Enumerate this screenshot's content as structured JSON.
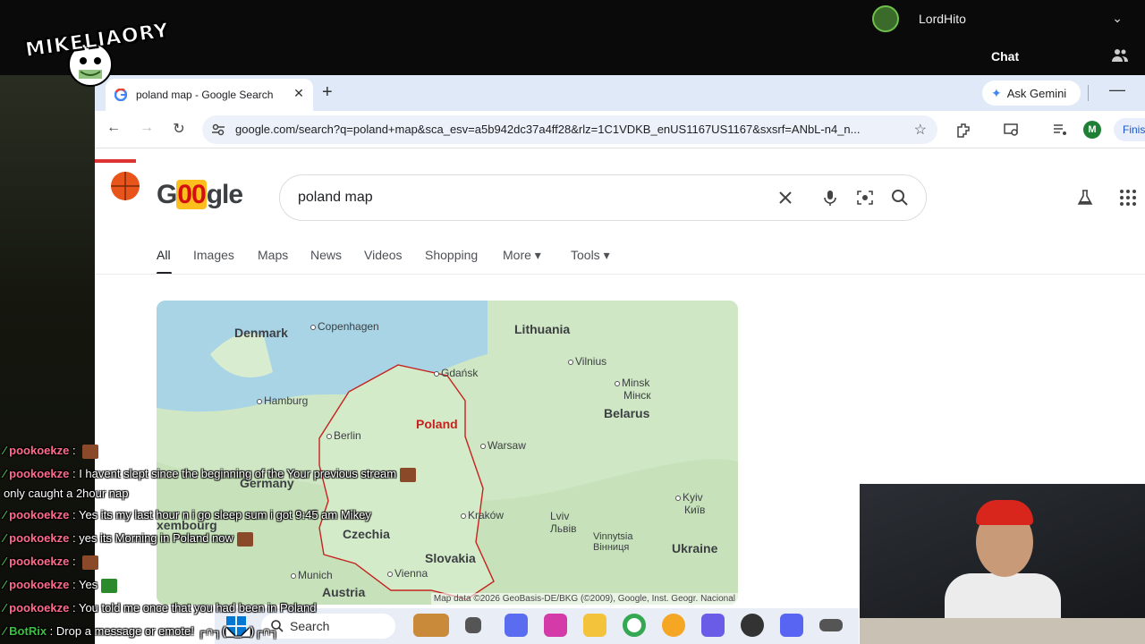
{
  "stream": {
    "logo_text": "MIKELIAORY",
    "username": "LordHito",
    "chat_title": "Chat"
  },
  "browser": {
    "tab_title": "poland map - Google Search",
    "ask_gemini_label": "Ask Gemini",
    "url": "google.com/search?q=poland+map&sca_esv=a5b942dc37a4ff28&rlz=1C1VDKB_enUS1167US1167&sxsrf=ANbL-n4_n...",
    "profile_initial": "M",
    "finish_label": "Finis"
  },
  "google": {
    "logo_g": "G",
    "logo_oo": "00",
    "logo_gle": "gle",
    "search_query": "poland map",
    "filters": [
      "All",
      "Images",
      "Maps",
      "News",
      "Videos",
      "Shopping",
      "More ▾",
      "Tools ▾"
    ]
  },
  "map": {
    "countries": {
      "denmark": "Denmark",
      "lithuania": "Lithuania",
      "poland": "Poland",
      "belarus": "Belarus",
      "germany": "Germany",
      "czechia": "Czechia",
      "slovakia": "Slovakia",
      "austria": "Austria",
      "ukraine": "Ukraine",
      "luxembourg": "xembourg"
    },
    "cities": {
      "copenhagen": "Copenhagen",
      "gdansk": "Gdańsk",
      "vilnius": "Vilnius",
      "minsk": "Minsk",
      "minsk_cyr": "Мінск",
      "hamburg": "Hamburg",
      "berlin": "Berlin",
      "warsaw": "Warsaw",
      "krakow": "Kraków",
      "lviv": "Lviv",
      "lviv_cyr": "Львів",
      "kyiv": "Kyiv",
      "kyiv_cyr": "Київ",
      "vinnytsia": "Vinnytsia",
      "vinnytsia_cyr": "Вінниця",
      "munich": "Munich",
      "vienna": "Vienna"
    },
    "attribution": "Map data ©2026 GeoBasis-DE/BKG (©2009), Google, Inst. Geogr. Nacional"
  },
  "chat": [
    {
      "user": "pookoekze",
      "text": ""
    },
    {
      "user": "pookoekze",
      "text": "I havent slept since the beginning of the Your previous stream"
    },
    {
      "user": "",
      "text": "only caught a 2hour nap"
    },
    {
      "user": "pookoekze",
      "text": "Yes its my last hour n i go sleep sum i got 9:45 am Mikey"
    },
    {
      "user": "pookoekze",
      "text": "yes its Morning in Poland now"
    },
    {
      "user": "pookoekze",
      "text": ""
    },
    {
      "user": "pookoekze",
      "text": "Yes"
    },
    {
      "user": "pookoekze",
      "text": "You told me once that you had been in Poland"
    },
    {
      "user": "BotRix",
      "text": "Drop a message or emote! ┌∩┐(◣_◢)┌∩┐"
    }
  ],
  "taskbar": {
    "search_label": "Search"
  },
  "colors": {
    "tab_bar": "#dfe9f7",
    "omnibox": "#edf2fa",
    "map_land": "#cfe7c4",
    "map_water": "#a8d4e6",
    "poland_border": "#c5221f",
    "chat_username": "#ff6b8b"
  }
}
